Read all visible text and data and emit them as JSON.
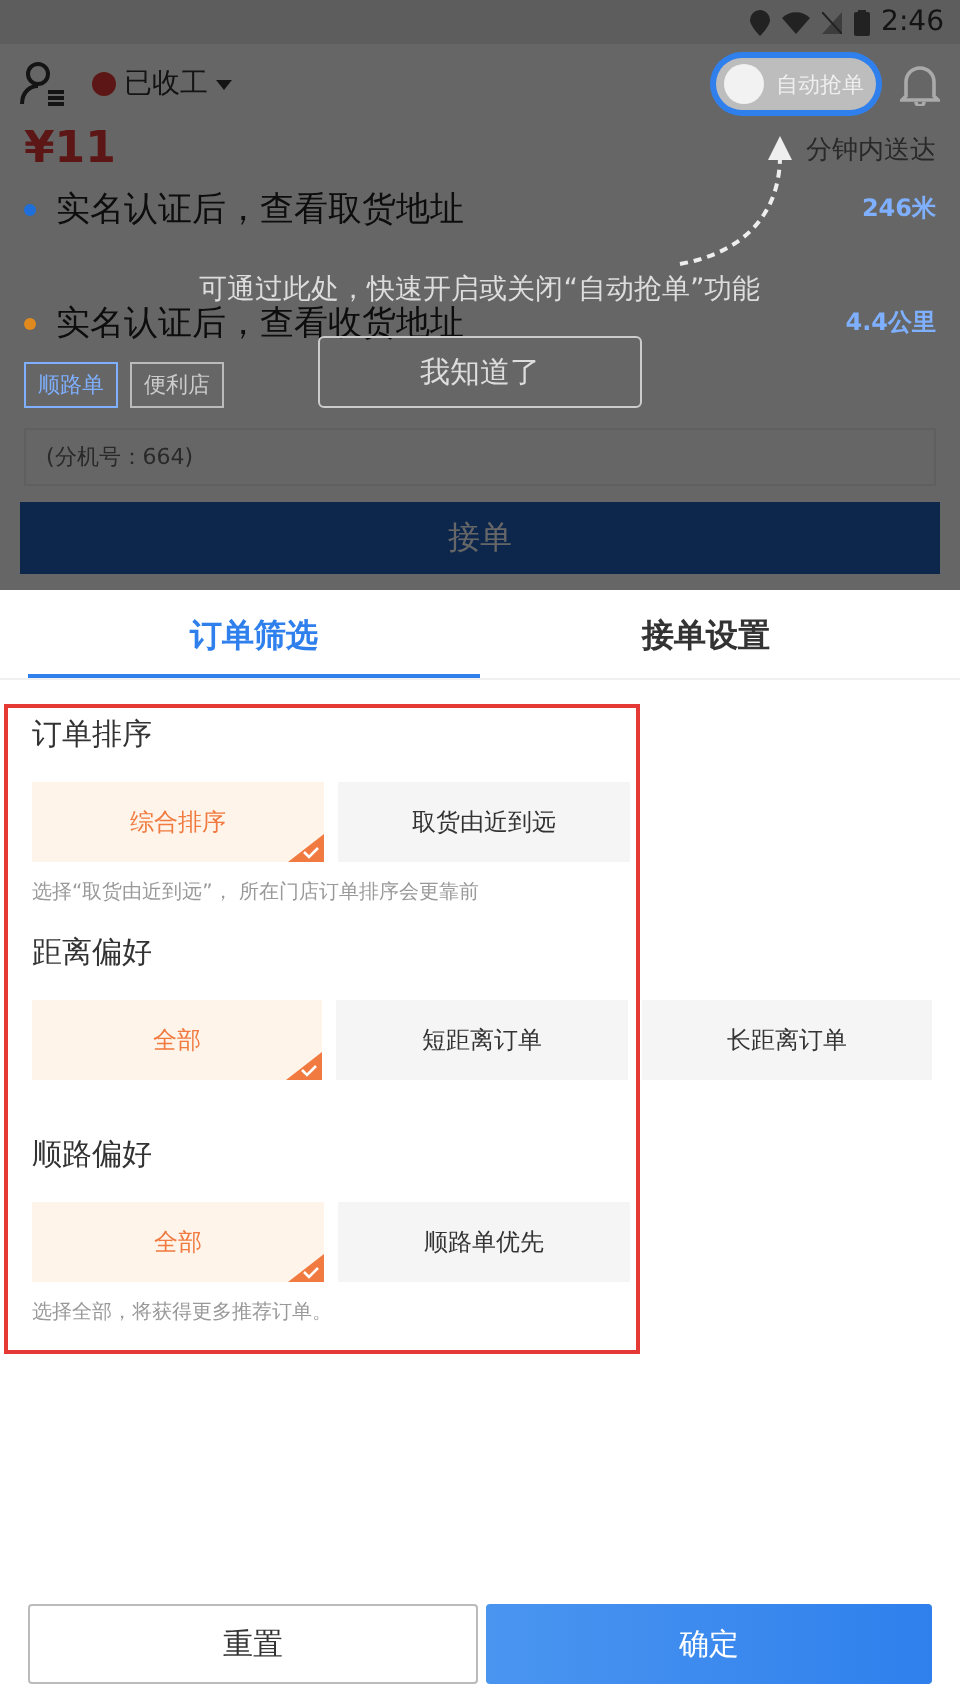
{
  "status_bar": {
    "time": "2:46"
  },
  "header": {
    "status": "已收工",
    "auto_toggle": {
      "label": "自动抢单",
      "on": false
    }
  },
  "order": {
    "price": "¥11",
    "delivery": "分钟内送达",
    "stops": [
      {
        "text": "实名认证后，查看取货地址",
        "distance": "246米",
        "color": "#1e6fd9"
      },
      {
        "text": "实名认证后，查看收货地址",
        "distance": "4.4公里",
        "color": "#e08a1e"
      }
    ],
    "tags": [
      "顺路单",
      "便利店"
    ],
    "phone": "(分机号：664)",
    "accept_button": "接单"
  },
  "guide": {
    "message": "可通过此处，快速开启或关闭“自动抢单”功能",
    "button": "我知道了"
  },
  "tabs": [
    {
      "label": "订单筛选",
      "selected": true
    },
    {
      "label": "接单设置",
      "selected": false
    }
  ],
  "sections": [
    {
      "title": "订单排序",
      "options": [
        {
          "label": "综合排序",
          "selected": true
        },
        {
          "label": "取货由近到远",
          "selected": false
        }
      ],
      "hint": "选择“取货由近到远”， 所在门店订单排序会更靠前"
    },
    {
      "title": "距离偏好",
      "options": [
        {
          "label": "全部",
          "selected": true
        },
        {
          "label": "短距离订单",
          "selected": false
        },
        {
          "label": "长距离订单",
          "selected": false
        }
      ]
    },
    {
      "title": "顺路偏好",
      "options": [
        {
          "label": "全部",
          "selected": true
        },
        {
          "label": "顺路单优先",
          "selected": false
        }
      ],
      "hint": "选择全部，将获得更多推荐订单。"
    }
  ],
  "buttons": {
    "reset": "重置",
    "confirm": "确定"
  }
}
